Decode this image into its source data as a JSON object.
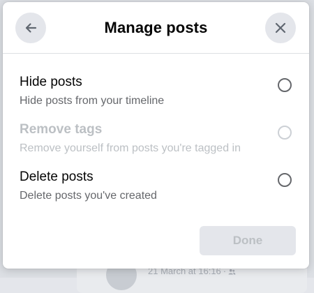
{
  "background": {
    "timestamp": "21 March at 16:16",
    "separator": "·",
    "audience_icon": "friends-icon"
  },
  "modal": {
    "title": "Manage posts",
    "back_icon": "arrow-left-icon",
    "close_icon": "close-icon",
    "options": [
      {
        "title": "Hide posts",
        "description": "Hide posts from your timeline",
        "enabled": true,
        "selected": false
      },
      {
        "title": "Remove tags",
        "description": "Remove yourself from posts you're tagged in",
        "enabled": false,
        "selected": false
      },
      {
        "title": "Delete posts",
        "description": "Delete posts you've created",
        "enabled": true,
        "selected": false
      }
    ],
    "done_label": "Done",
    "done_enabled": false
  },
  "colors": {
    "primary_text": "#050505",
    "secondary_text": "#65676b",
    "disabled_text": "#bcc0c4",
    "button_background": "#e4e6eb",
    "divider": "#dddfe2"
  }
}
